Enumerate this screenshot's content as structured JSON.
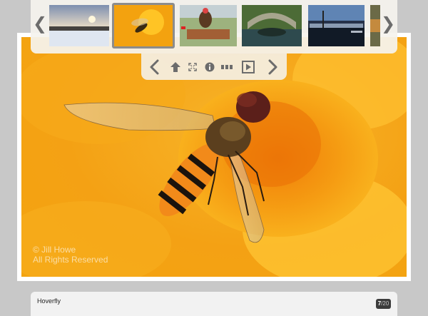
{
  "filmstrip": {
    "prev_label": "❮",
    "next_label": "❯",
    "thumbnails": [
      {
        "name": "winter-sunset"
      },
      {
        "name": "hoverfly",
        "active": true
      },
      {
        "name": "horse-jumping"
      },
      {
        "name": "stone-bridge"
      },
      {
        "name": "city-waterfront"
      },
      {
        "name": "partial-thumbnail"
      }
    ]
  },
  "watermark": {
    "line1": "© Jill Howe",
    "line2": "All Rights Reserved"
  },
  "controls": {
    "icons": [
      "chevron-left-icon",
      "home-icon",
      "fullscreen-icon",
      "info-icon",
      "thumbnails-icon",
      "play-icon",
      "chevron-right-icon"
    ]
  },
  "caption": {
    "title": "Hoverfly",
    "current": "7",
    "total": "/20"
  },
  "colors": {
    "photo_orange": "#f5a512",
    "frame": "#ffffff",
    "background": "#c8c8c8",
    "icon_gray": "#6c6c6c"
  }
}
